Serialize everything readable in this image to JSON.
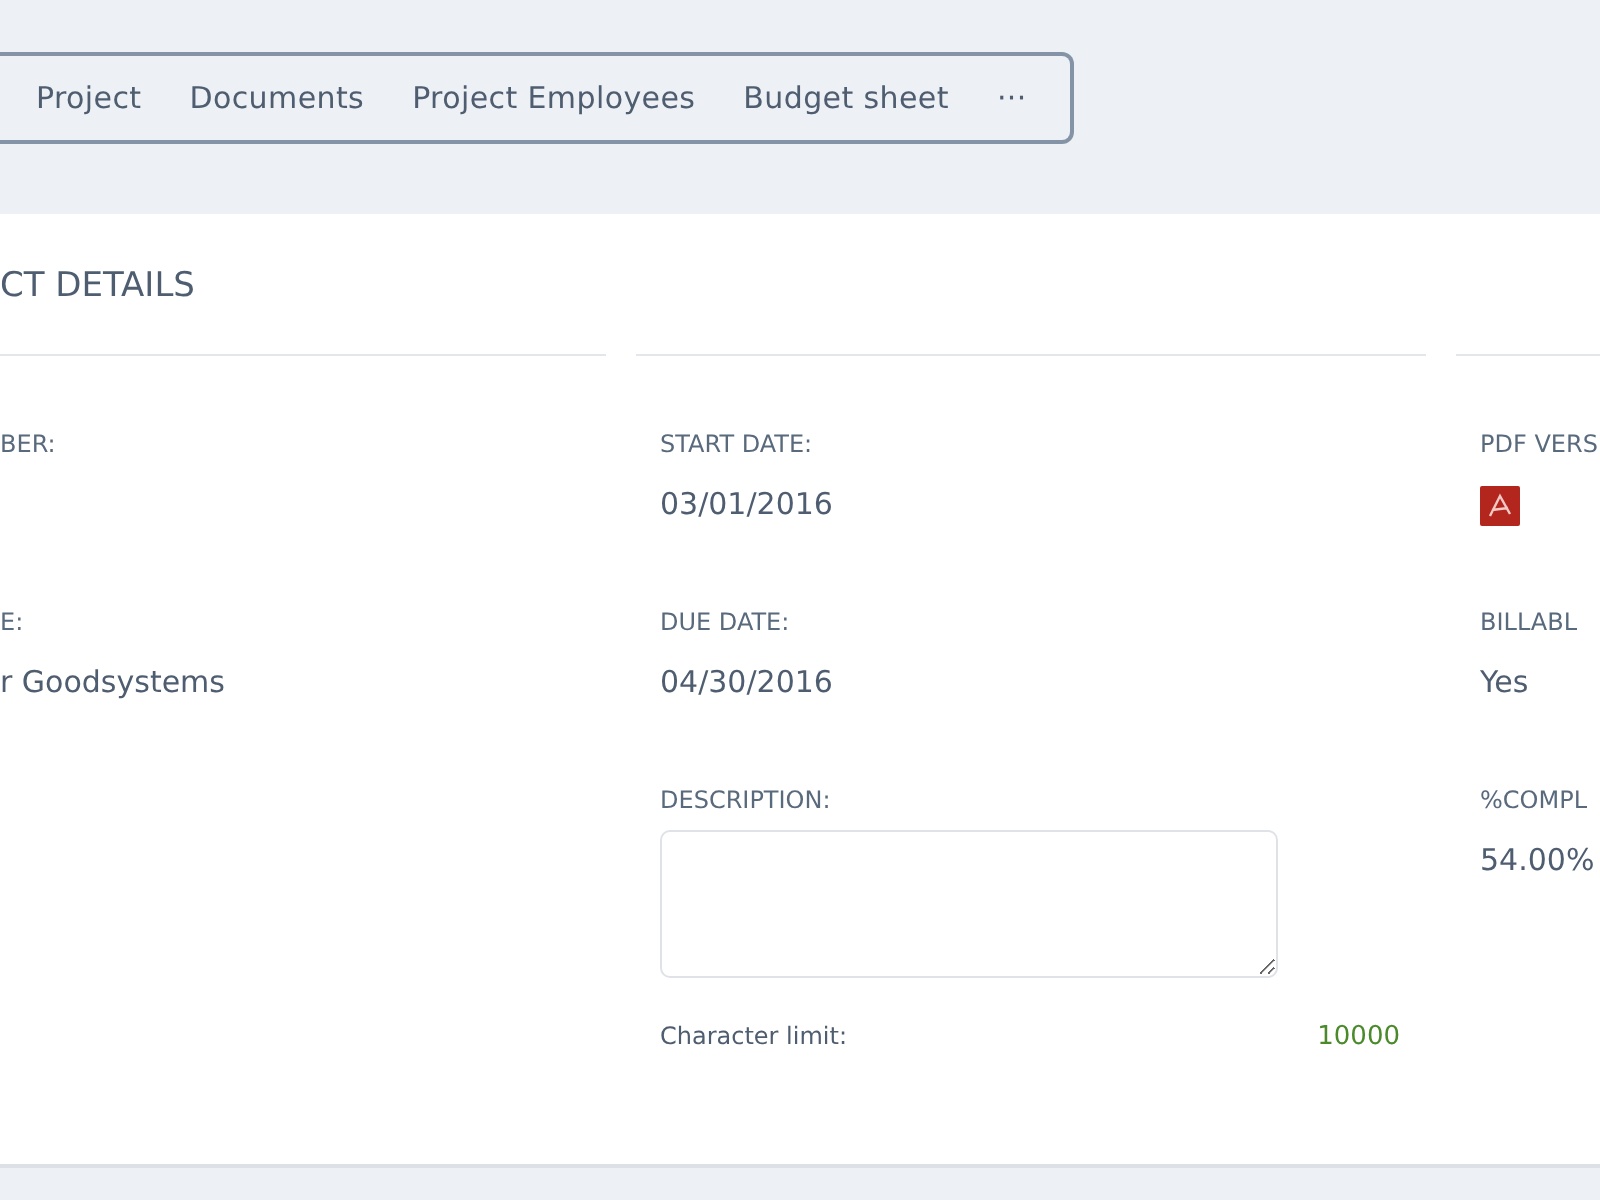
{
  "tabs": [
    {
      "label": "Project"
    },
    {
      "label": "Documents"
    },
    {
      "label": "Project Employees"
    },
    {
      "label": "Budget sheet"
    },
    {
      "label": "···"
    }
  ],
  "section": {
    "title": "CT DETAILS"
  },
  "columns": [
    {
      "fields": [
        {
          "kind": "text",
          "label": "BER:"
        },
        {
          "kind": "text",
          "label": "E:",
          "value": "r Goodsystems"
        }
      ]
    },
    {
      "fields": [
        {
          "kind": "text",
          "label": "START DATE:",
          "value": "03/01/2016"
        },
        {
          "kind": "text",
          "label": "DUE DATE:",
          "value": "04/30/2016"
        },
        {
          "kind": "textarea",
          "label": "DESCRIPTION:",
          "limit_label": "Character limit:",
          "limit": "10000"
        }
      ]
    },
    {
      "fields": [
        {
          "kind": "pdf",
          "label": "PDF VERS"
        },
        {
          "kind": "text",
          "label": "BILLABL",
          "value": "Yes"
        },
        {
          "kind": "text",
          "label": "%COMPL",
          "value": "54.00%"
        }
      ]
    }
  ]
}
